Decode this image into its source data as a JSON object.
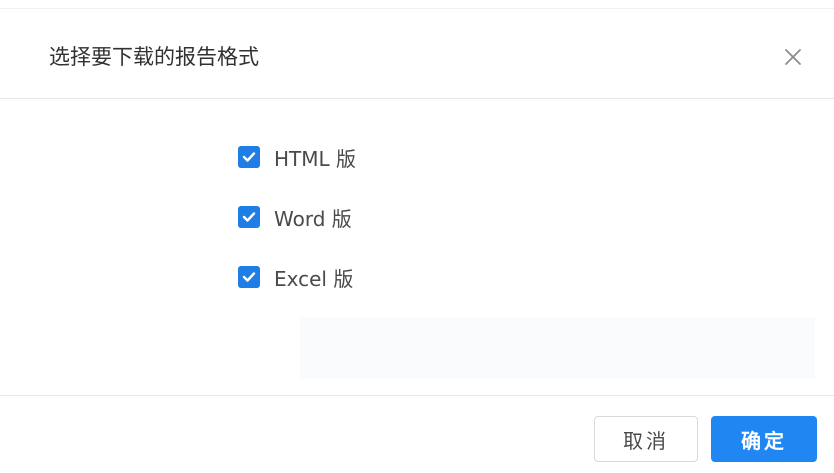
{
  "dialog": {
    "title": "选择要下载的报告格式",
    "close_icon": "close-icon"
  },
  "options": [
    {
      "label": "HTML 版",
      "checked": true
    },
    {
      "label": "Word 版",
      "checked": true
    },
    {
      "label": "Excel 版",
      "checked": true
    }
  ],
  "footer": {
    "cancel_label": "取消",
    "confirm_label": "确定"
  },
  "colors": {
    "accent": "#1f86f2",
    "checkbox": "#1f7de6",
    "title_text": "#303133",
    "body_text": "#4a4a4a"
  }
}
